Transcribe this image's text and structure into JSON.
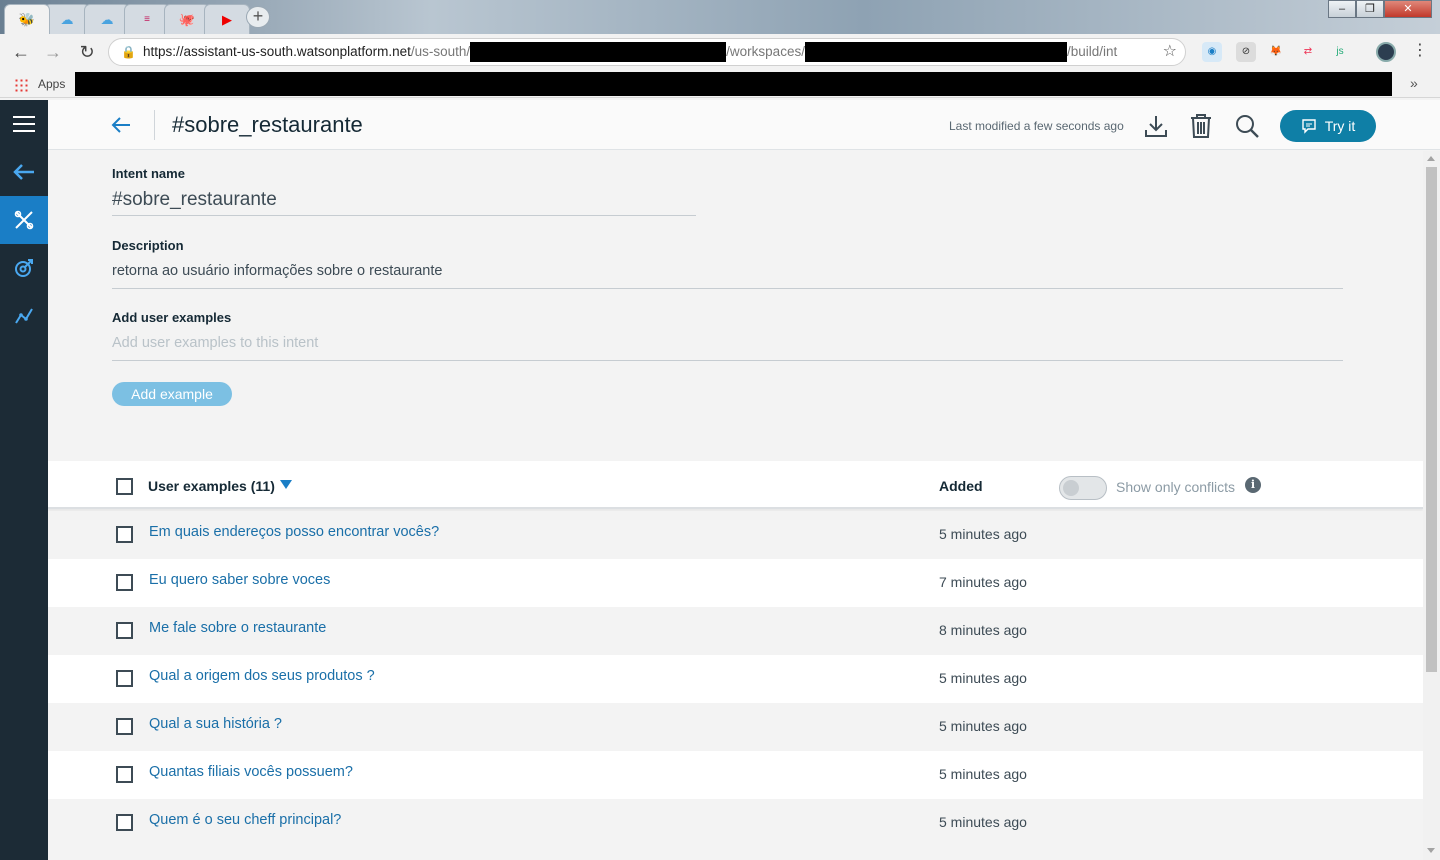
{
  "browser": {
    "url_prefix": "https://assistant-us-south.watsonplatform.net",
    "url_part1": "/us-south/",
    "url_part2": "/workspaces/",
    "url_part3": "/build/int",
    "bookmarks_apps_label": "Apps",
    "window_controls": [
      "–",
      "❐",
      "✕"
    ],
    "nav": {
      "back": "←",
      "forward": "→",
      "reload": "↻"
    },
    "more_bookmarks": "»"
  },
  "app": {
    "title": "#sobre_restaurante",
    "last_modified": "Last modified a few seconds ago",
    "try_it_label": "Try it",
    "form": {
      "intent_name_label": "Intent name",
      "intent_name_value": "#sobre_restaurante",
      "description_label": "Description",
      "description_value": "retorna ao usuário informações sobre o restaurante",
      "add_examples_label": "Add user examples",
      "add_examples_placeholder": "Add user examples to this intent",
      "add_example_button": "Add example"
    },
    "table": {
      "examples_header": "User examples (11)",
      "added_header": "Added",
      "conflicts_label": "Show only conflicts",
      "info_glyph": "i",
      "rows": [
        {
          "text": "Em quais endereços posso encontrar vocês?",
          "added": "5 minutes ago"
        },
        {
          "text": "Eu quero saber sobre voces",
          "added": "7 minutes ago"
        },
        {
          "text": "Me fale sobre o restaurante",
          "added": "8 minutes ago"
        },
        {
          "text": "Qual a origem dos seus produtos ?",
          "added": "5 minutes ago"
        },
        {
          "text": "Qual a sua história ?",
          "added": "5 minutes ago"
        },
        {
          "text": "Quantas filiais vocês possuem?",
          "added": "5 minutes ago"
        },
        {
          "text": "Quem é o seu cheff principal?",
          "added": "5 minutes ago"
        }
      ]
    }
  },
  "colors": {
    "rail_bg": "#1c2b36",
    "rail_active": "#1a7ec6",
    "link": "#1a6fa8",
    "try_it_bg": "#0f7fa6",
    "add_button_bg": "#7cc0e3"
  },
  "icons": {
    "rail": [
      "menu-icon",
      "back-arrow-icon",
      "build-tools-icon",
      "improve-icon",
      "analytics-icon"
    ],
    "header": [
      "download-icon",
      "trash-icon",
      "search-icon",
      "chat-icon"
    ]
  }
}
